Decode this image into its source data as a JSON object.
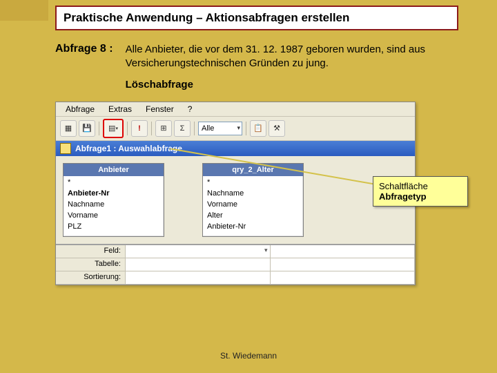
{
  "title": "Praktische Anwendung – Aktionsabfragen erstellen",
  "query": {
    "label": "Abfrage 8 :",
    "description": "Alle Anbieter, die vor dem 31. 12. 1987 geboren wurden, sind aus Versicherungstechnischen Gründen zu jung.",
    "subtitle": "Löschabfrage"
  },
  "menubar": {
    "items": [
      "Abfrage",
      "Extras",
      "Fenster",
      "?"
    ]
  },
  "toolbar": {
    "combo_value": "Alle"
  },
  "query_window": {
    "title": "Abfrage1 : Auswahlabfrage"
  },
  "tables": [
    {
      "title": "Anbieter",
      "fields": [
        "*",
        "Anbieter-Nr",
        "Nachname",
        "Vorname",
        "PLZ"
      ],
      "bold_index": 1
    },
    {
      "title": "qry_2_Alter",
      "fields": [
        "*",
        "Nachname",
        "Vorname",
        "Alter",
        "Anbieter-Nr"
      ],
      "bold_index": -1
    }
  ],
  "grid": {
    "rows": [
      "Feld:",
      "Tabelle:",
      "Sortierung:"
    ]
  },
  "callout": {
    "line1": "Schaltfläche",
    "line2": "Abfragetyp"
  },
  "footer": "St. Wiedemann"
}
